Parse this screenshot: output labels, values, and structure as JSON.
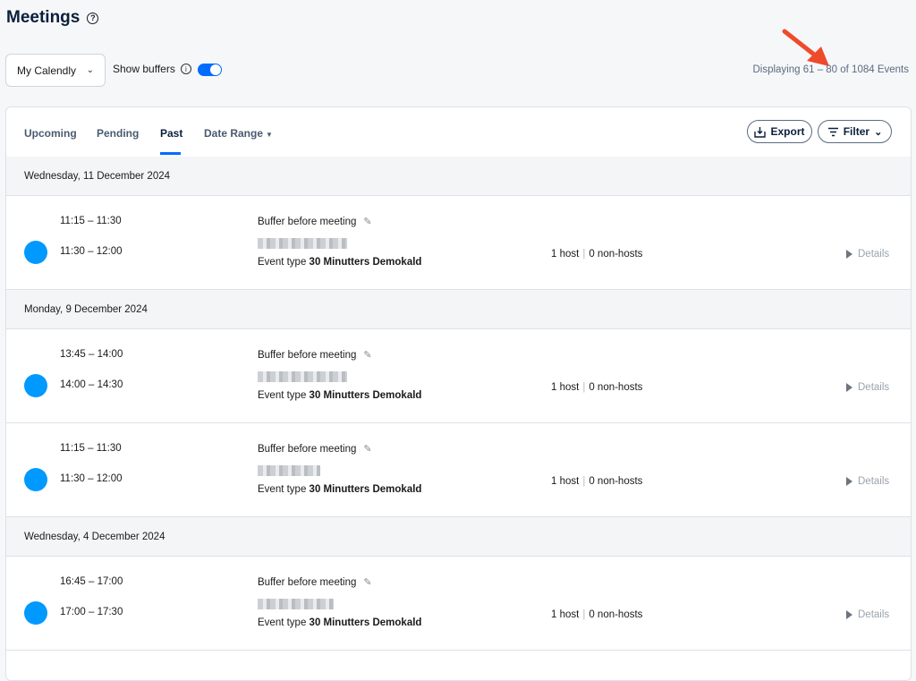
{
  "page": {
    "title": "Meetings"
  },
  "controls": {
    "calendar_select": "My Calendly",
    "show_buffers_label": "Show buffers",
    "buffers_on": true,
    "displaying": "Displaying 61 – 80 of 1084 Events"
  },
  "tabs": [
    {
      "label": "Upcoming"
    },
    {
      "label": "Pending"
    },
    {
      "label": "Past"
    },
    {
      "label": "Date Range"
    }
  ],
  "active_tab": "Past",
  "actions": {
    "export": "Export",
    "filter": "Filter"
  },
  "dates": [
    {
      "label": "Wednesday, 11 December 2024"
    },
    {
      "label": "Monday, 9 December 2024"
    },
    {
      "label": "Wednesday, 4 December 2024"
    }
  ],
  "events": [
    {
      "buffer_time": "11:15 – 11:30",
      "time": "11:30 – 12:00",
      "buffer_label": "Buffer before meeting",
      "event_type_label": "Event type",
      "event_type": "30 Minutters Demokald",
      "host_count": "1 host",
      "non_host_count": "0 non-hosts",
      "details": "Details"
    },
    {
      "buffer_time": "13:45 – 14:00",
      "time": "14:00 – 14:30",
      "buffer_label": "Buffer before meeting",
      "event_type_label": "Event type",
      "event_type": "30 Minutters Demokald",
      "host_count": "1 host",
      "non_host_count": "0 non-hosts",
      "details": "Details"
    },
    {
      "buffer_time": "11:15 – 11:30",
      "time": "11:30 – 12:00",
      "buffer_label": "Buffer before meeting",
      "event_type_label": "Event type",
      "event_type": "30 Minutters Demokald",
      "host_count": "1 host",
      "non_host_count": "0 non-hosts",
      "details": "Details"
    },
    {
      "buffer_time": "16:45 – 17:00",
      "time": "17:00 – 17:30",
      "buffer_label": "Buffer before meeting",
      "event_type_label": "Event type",
      "event_type": "30 Minutters Demokald",
      "host_count": "1 host",
      "non_host_count": "0 non-hosts",
      "details": "Details"
    }
  ],
  "colors": {
    "accent": "#006bff",
    "event_dot": "#0099ff",
    "arrow": "#ee4b2b"
  }
}
